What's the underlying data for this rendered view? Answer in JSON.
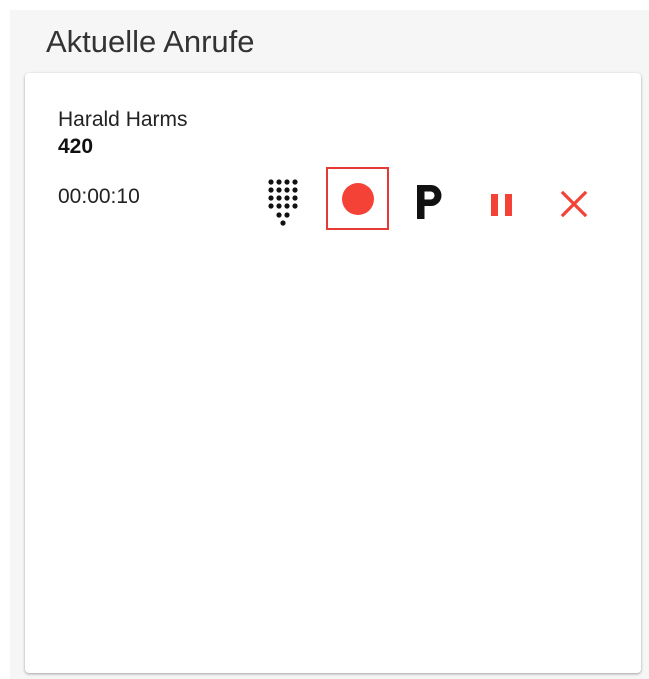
{
  "panel": {
    "title": "Aktuelle Anrufe"
  },
  "call": {
    "name": "Harald Harms",
    "number": "420",
    "duration": "00:00:10"
  },
  "actions": [
    {
      "id": "dialpad",
      "icon": "dialpad-icon"
    },
    {
      "id": "record",
      "icon": "record-icon",
      "selected": true
    },
    {
      "id": "park",
      "icon": "park-icon",
      "glyph": "P"
    },
    {
      "id": "hold",
      "icon": "pause-icon"
    },
    {
      "id": "hangup",
      "icon": "close-icon"
    }
  ],
  "colors": {
    "accent": "#f44336",
    "selection_border": "#e53935",
    "icon_dark": "#111111",
    "panel_background": "#f6f6f6",
    "card_background": "#ffffff"
  }
}
